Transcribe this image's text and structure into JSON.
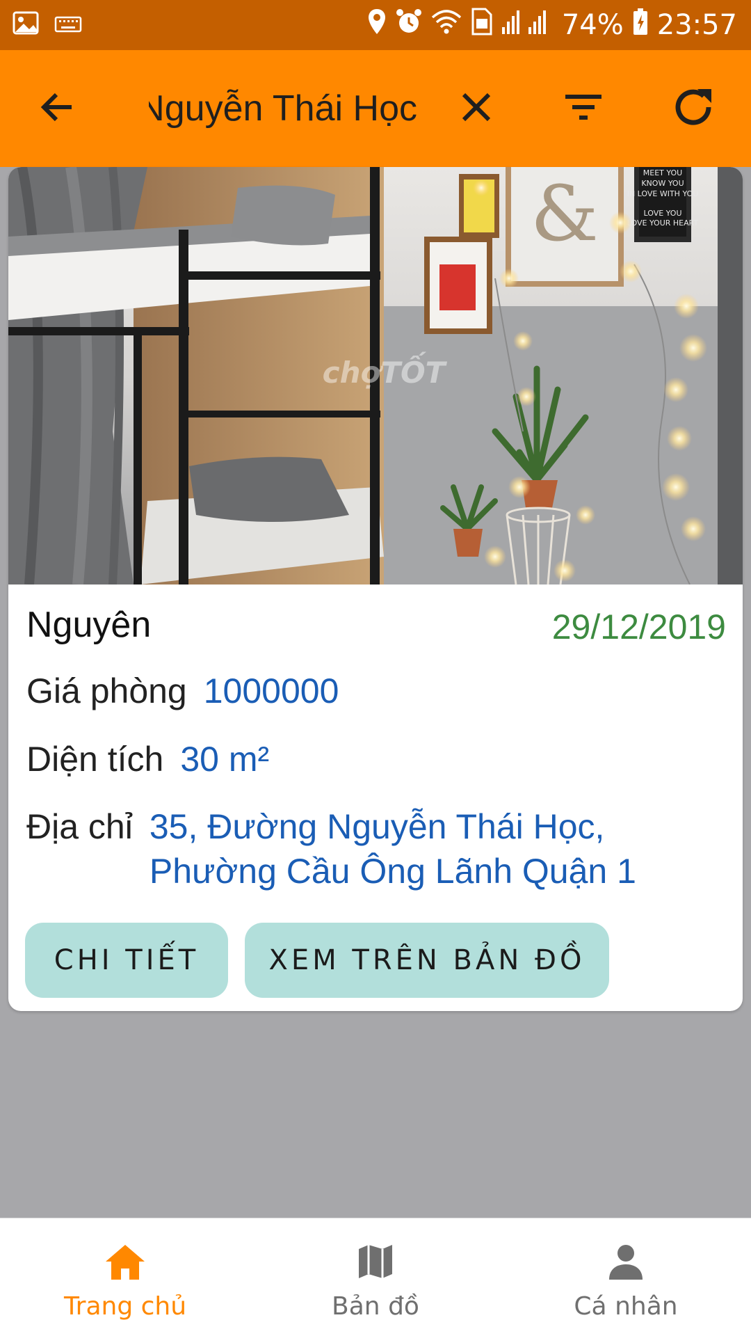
{
  "status_bar": {
    "battery": "74%",
    "time": "23:57",
    "left_icons": [
      "image-icon",
      "keyboard-icon"
    ],
    "right_icons": [
      "location-icon",
      "alarm-icon",
      "wifi-icon",
      "sim-icon",
      "signal-icon",
      "battery-icon"
    ]
  },
  "app_bar": {
    "search_value": "Nguyễn Thái Học",
    "back_icon": "arrow-left-icon",
    "clear_icon": "close-icon",
    "filter_icon": "filter-icon",
    "refresh_icon": "refresh-icon"
  },
  "listing": {
    "photo_watermark": "chợTỐT",
    "owner": "Nguyên",
    "date": "29/12/2019",
    "price_label": "Giá phòng",
    "price_value": "1000000",
    "area_label": "Diện tích",
    "area_value": "30 m²",
    "address_label": "Địa chỉ",
    "address_line1": "35, Đường Nguyễn Thái Học,",
    "address_line2": "Phường Cầu Ông Lãnh Quận 1",
    "details_button": "CHI TIẾT",
    "map_button": "XEM TRÊN BẢN ĐỒ"
  },
  "bottom_nav": {
    "items": [
      {
        "label": "Trang chủ",
        "icon": "home-icon",
        "active": true
      },
      {
        "label": "Bản đồ",
        "icon": "map-icon",
        "active": false
      },
      {
        "label": "Cá nhân",
        "icon": "person-icon",
        "active": false
      }
    ]
  },
  "colors": {
    "status_bar": "#c45f00",
    "app_bar": "#ff8800",
    "date_text": "#3d8b40",
    "value_text": "#1a5db5",
    "button_bg": "#b2dfdb",
    "active_nav": "#ff8800",
    "inactive_nav": "#6f6f6f"
  }
}
